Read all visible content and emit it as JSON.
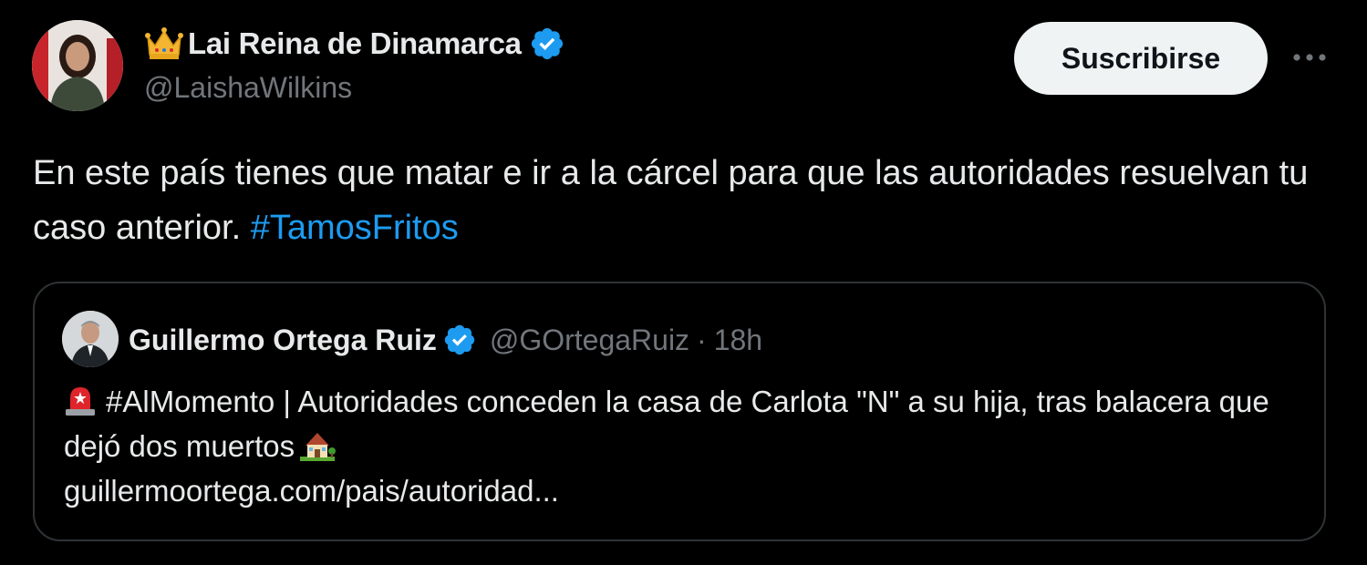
{
  "tweet": {
    "display_name": "Lai Reina de Dinamarca",
    "handle": "@LaishaWilkins",
    "subscribe_label": "Suscribirse",
    "more_label": "···",
    "text_main": "En este país tienes que matar e ir a la cárcel para que las autoridades resuelvan tu caso anterior. ",
    "hashtag": "#TamosFritos"
  },
  "quote": {
    "display_name": "Guillermo Ortega Ruiz",
    "handle": "@GOrtegaRuiz",
    "separator": "·",
    "time": "18h",
    "text_line": "#AlMomento | Autoridades conceden la casa de Carlota \"N\" a su hija, tras balacera que dejó dos muertos",
    "link": "guillermoortega.com/pais/autoridad..."
  },
  "icons": {
    "crown": "crown-icon",
    "verified": "verified-badge-icon",
    "more": "more-options-icon",
    "siren": "siren-icon",
    "house": "house-icon"
  },
  "colors": {
    "background": "#000000",
    "text": "#e7e9ea",
    "secondary": "#71767b",
    "link": "#1d9bf0",
    "verified": "#1d9bf0",
    "button_bg": "#eff3f4",
    "border": "#2f3336"
  }
}
